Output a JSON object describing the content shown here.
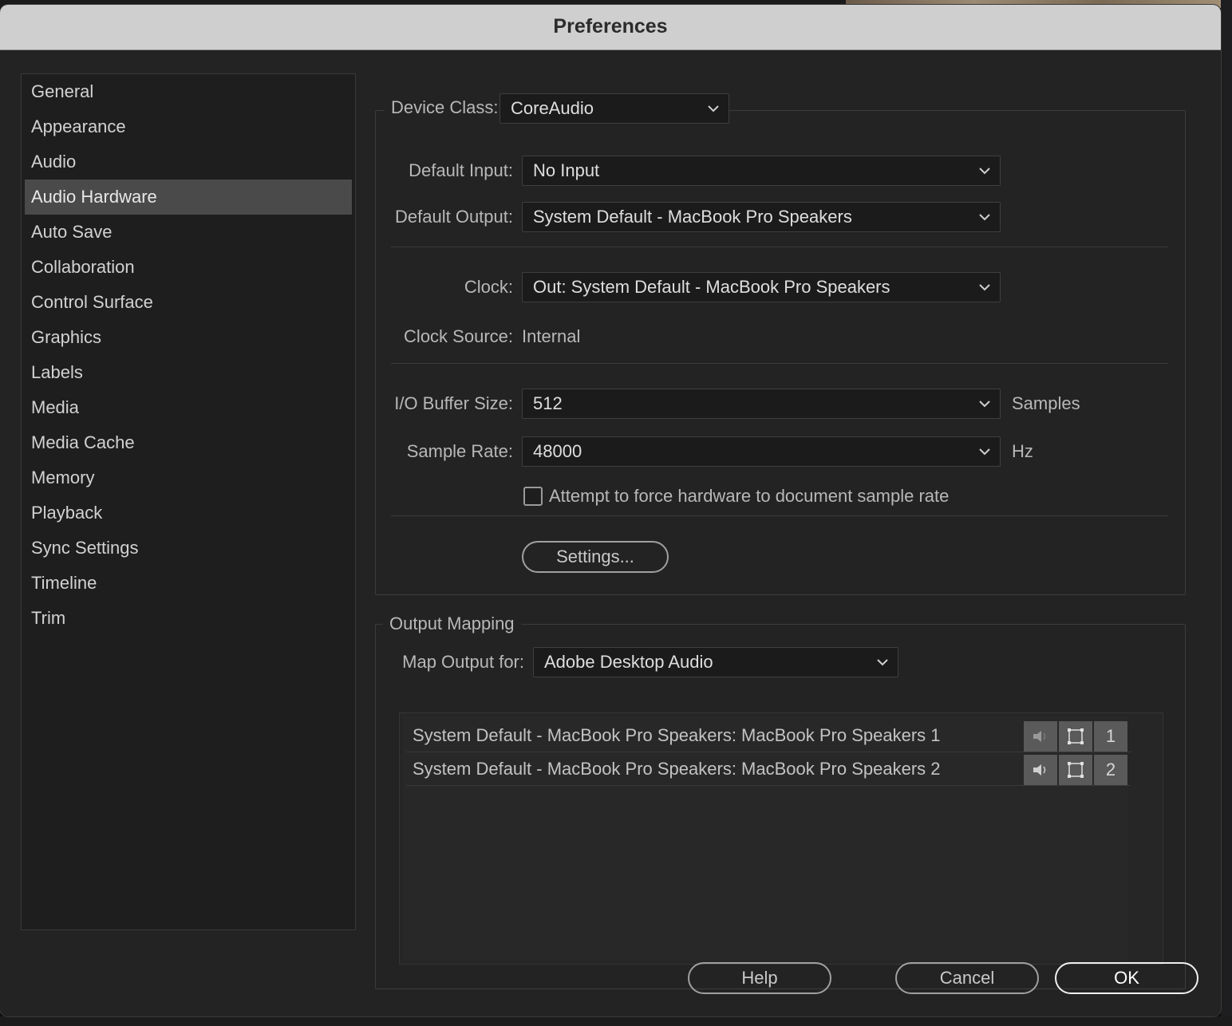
{
  "window": {
    "title": "Preferences"
  },
  "sidebar": {
    "items": [
      {
        "label": "General"
      },
      {
        "label": "Appearance"
      },
      {
        "label": "Audio"
      },
      {
        "label": "Audio Hardware",
        "selected": true
      },
      {
        "label": "Auto Save"
      },
      {
        "label": "Collaboration"
      },
      {
        "label": "Control Surface"
      },
      {
        "label": "Graphics"
      },
      {
        "label": "Labels"
      },
      {
        "label": "Media"
      },
      {
        "label": "Media Cache"
      },
      {
        "label": "Memory"
      },
      {
        "label": "Playback"
      },
      {
        "label": "Sync Settings"
      },
      {
        "label": "Timeline"
      },
      {
        "label": "Trim"
      }
    ]
  },
  "hardware": {
    "device_class_label": "Device Class:",
    "device_class_value": "CoreAudio",
    "default_input_label": "Default Input:",
    "default_input_value": "No Input",
    "default_output_label": "Default Output:",
    "default_output_value": "System Default - MacBook Pro Speakers",
    "clock_label": "Clock:",
    "clock_value": "Out: System Default - MacBook Pro Speakers",
    "clock_source_label": "Clock Source:",
    "clock_source_value": "Internal",
    "buffer_label": "I/O Buffer Size:",
    "buffer_value": "512",
    "buffer_unit": "Samples",
    "sample_rate_label": "Sample Rate:",
    "sample_rate_value": "48000",
    "sample_rate_unit": "Hz",
    "force_rate_label": "Attempt to force hardware to document sample rate",
    "force_rate_checked": false,
    "settings_button": "Settings..."
  },
  "output_mapping": {
    "legend": "Output Mapping",
    "map_for_label": "Map Output for:",
    "map_for_value": "Adobe Desktop Audio",
    "rows": [
      {
        "label": "System Default - MacBook Pro Speakers: MacBook Pro Speakers 1",
        "channel": "1"
      },
      {
        "label": "System Default - MacBook Pro Speakers: MacBook Pro Speakers 2",
        "channel": "2"
      }
    ]
  },
  "footer": {
    "help": "Help",
    "cancel": "Cancel",
    "ok": "OK"
  }
}
